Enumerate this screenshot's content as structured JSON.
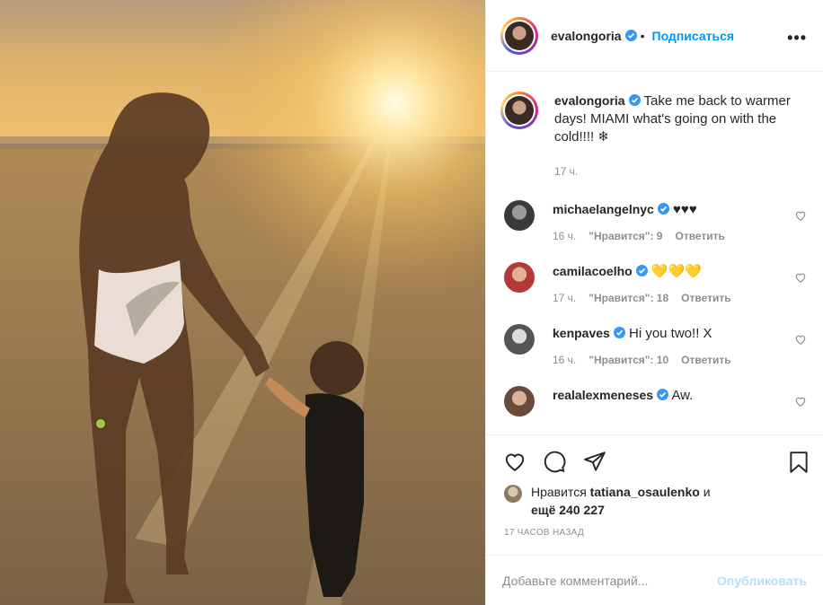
{
  "post": {
    "username": "evalongoria",
    "follow_label": "Подписаться",
    "more_label": "•••",
    "caption_text": "Take me back to warmer days! MIAMI what's going on with the cold!!!! ❄",
    "caption_time": "17 ч."
  },
  "comments": [
    {
      "user": "michaelangelnyc",
      "text": "♥♥♥",
      "time": "16 ч.",
      "likes": "\"Нравится\": 9",
      "reply": "Ответить"
    },
    {
      "user": "camilacoelho",
      "text": "💛💛💛",
      "time": "17 ч.",
      "likes": "\"Нравится\": 18",
      "reply": "Ответить"
    },
    {
      "user": "kenpaves",
      "text": "Hi you two!! X",
      "time": "16 ч.",
      "likes": "\"Нравится\": 10",
      "reply": "Ответить"
    },
    {
      "user": "realalexmeneses",
      "text": "Aw."
    }
  ],
  "likes": {
    "prefix": "Нравится",
    "user": "tatiana_osaulenko",
    "and": "и",
    "count": "ещё 240 227"
  },
  "posted_ago": "17 ЧАСОВ НАЗАД",
  "add_comment": {
    "placeholder": "Добавьте комментарий...",
    "publish": "Опубликовать"
  },
  "colors": {
    "link": "#0095f6",
    "verified": "#3897f0",
    "muted": "#8e8e8e",
    "publish_disabled": "#b2dffc"
  },
  "icons": [
    "heart-icon",
    "comment-icon",
    "share-icon",
    "bookmark-icon",
    "verified-icon",
    "more-icon"
  ]
}
